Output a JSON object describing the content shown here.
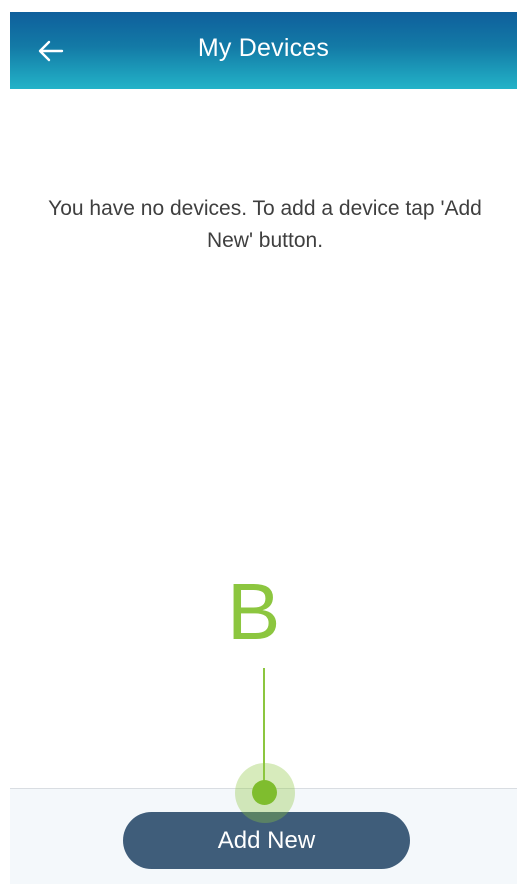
{
  "header": {
    "title": "My Devices",
    "back_icon": "arrow-left-icon"
  },
  "content": {
    "empty_message": "You have no devices. To add a device tap 'Add New' button."
  },
  "annotation": {
    "letter": "B",
    "color": "#8cc63f"
  },
  "footer": {
    "add_button_label": "Add New"
  },
  "colors": {
    "header_gradient_top": "#0f5f9c",
    "header_gradient_bottom": "#23b3c8",
    "button_bg": "#3f5d7a",
    "footer_bg": "#f4f8fb"
  }
}
